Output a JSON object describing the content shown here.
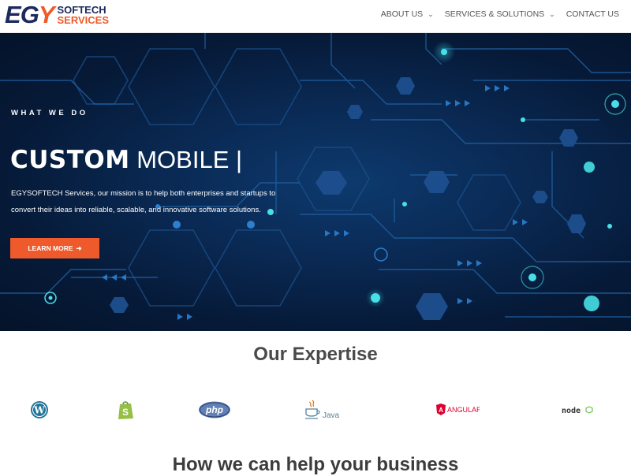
{
  "brand": {
    "mark": "EGY",
    "line1": "SOFTECH",
    "line2": "SERVICES",
    "primary_color": "#1c2a5c",
    "accent_color": "#f05a28"
  },
  "nav": {
    "items": [
      {
        "label": "ABOUT US",
        "dropdown": true
      },
      {
        "label": "SERVICES & SOLUTIONS",
        "dropdown": true
      },
      {
        "label": "CONTACT US",
        "dropdown": false
      }
    ]
  },
  "hero": {
    "eyebrow": "WHAT WE DO",
    "title_bold": "CUSTOM",
    "title_rest": "MOBILE |",
    "description": "EGYSOFTECH Services, our mission is to help both enterprises and startups to convert their ideas into reliable, scalable, and innovative software solutions.",
    "cta_label": "LEARN MORE",
    "cta_color": "#ee5a2b"
  },
  "expertise": {
    "title": "Our Expertise",
    "technologies": [
      {
        "name": "WordPress",
        "icon": "wordpress-icon"
      },
      {
        "name": "Shopify",
        "icon": "shopify-icon"
      },
      {
        "name": "php",
        "icon": "php-icon"
      },
      {
        "name": "Java",
        "icon": "java-icon"
      },
      {
        "name": "ANGULAR",
        "icon": "angular-icon"
      },
      {
        "name": "node",
        "icon": "nodejs-icon"
      }
    ]
  },
  "help": {
    "title": "How we can help your business"
  }
}
